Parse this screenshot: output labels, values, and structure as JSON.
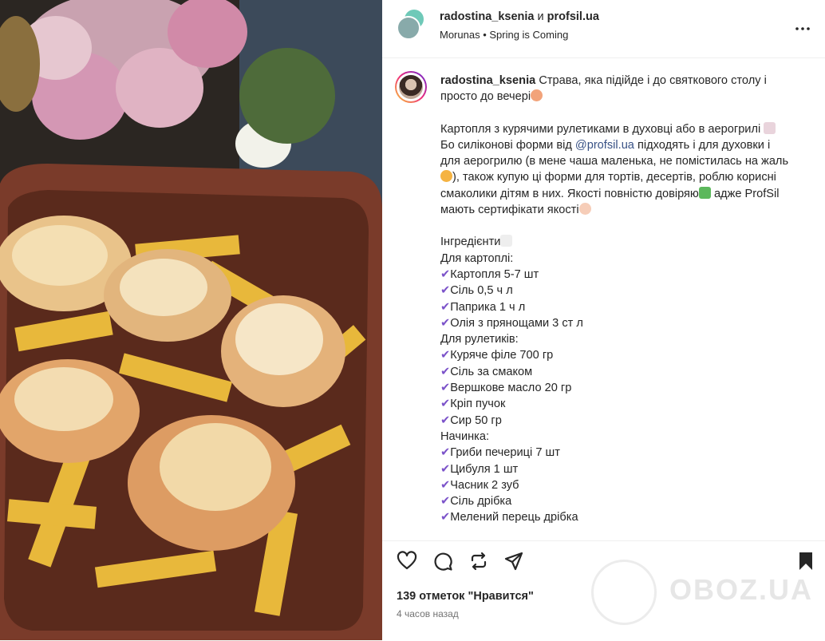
{
  "header": {
    "user1": "radostina_ksenia",
    "and": "и",
    "user2": "profsil.ua",
    "subtitle": "Morunas • Spring is Coming"
  },
  "caption": {
    "username": "radostina_ksenia",
    "intro": "Страва, яка підійде і до святкового столу і просто до вечері",
    "dish": "Картопля з курячими рулетиками в духовці або в аерогрилі",
    "p1a": "Бо силіконові форми від ",
    "mention": "@profsil.ua",
    "p1b": " підходять і для духовки і для аерогрилю (в мене чаша маленька, не помістилась на жаль",
    "p1c": "), також купую ці форми для тортів, десертів, роблю корисні смаколики дітям в них. Якості повністю довіряю",
    "p1d": "адже ProfSil мають сертифікати якості",
    "ingredients_title": "Інгредієнти",
    "potato_title": "Для картоплі:",
    "potato_items": [
      "Картопля 5-7 шт",
      "Сіль 0,5 ч л",
      "Паприка 1 ч л",
      "Олія з прянощами 3 ст л"
    ],
    "roll_title": "Для рулетиків:",
    "roll_items": [
      "Куряче філе 700 гр",
      "Сіль за смаком",
      "Вершкове масло 20 гр",
      "Кріп пучок",
      "Сир 50 гр"
    ],
    "filling_title": "Начинка:",
    "filling_items": [
      "Гриби печериці 7 шт",
      "Цибуля 1 шт",
      "Часник 2 зуб",
      "Сіль дрібка",
      "Мелений перець дрібка"
    ]
  },
  "footer": {
    "likes": "139 отметок \"Нравится\"",
    "time": "4 часов назад",
    "watermark": "OBOZ.UA"
  },
  "icons": {
    "like": "heart-icon",
    "comment": "comment-icon",
    "repost": "repost-icon",
    "share": "send-icon",
    "save": "bookmark-icon",
    "more": "more-icon"
  },
  "colors": {
    "mention": "#385185",
    "check": "#7b52c9",
    "muted": "#737373"
  }
}
